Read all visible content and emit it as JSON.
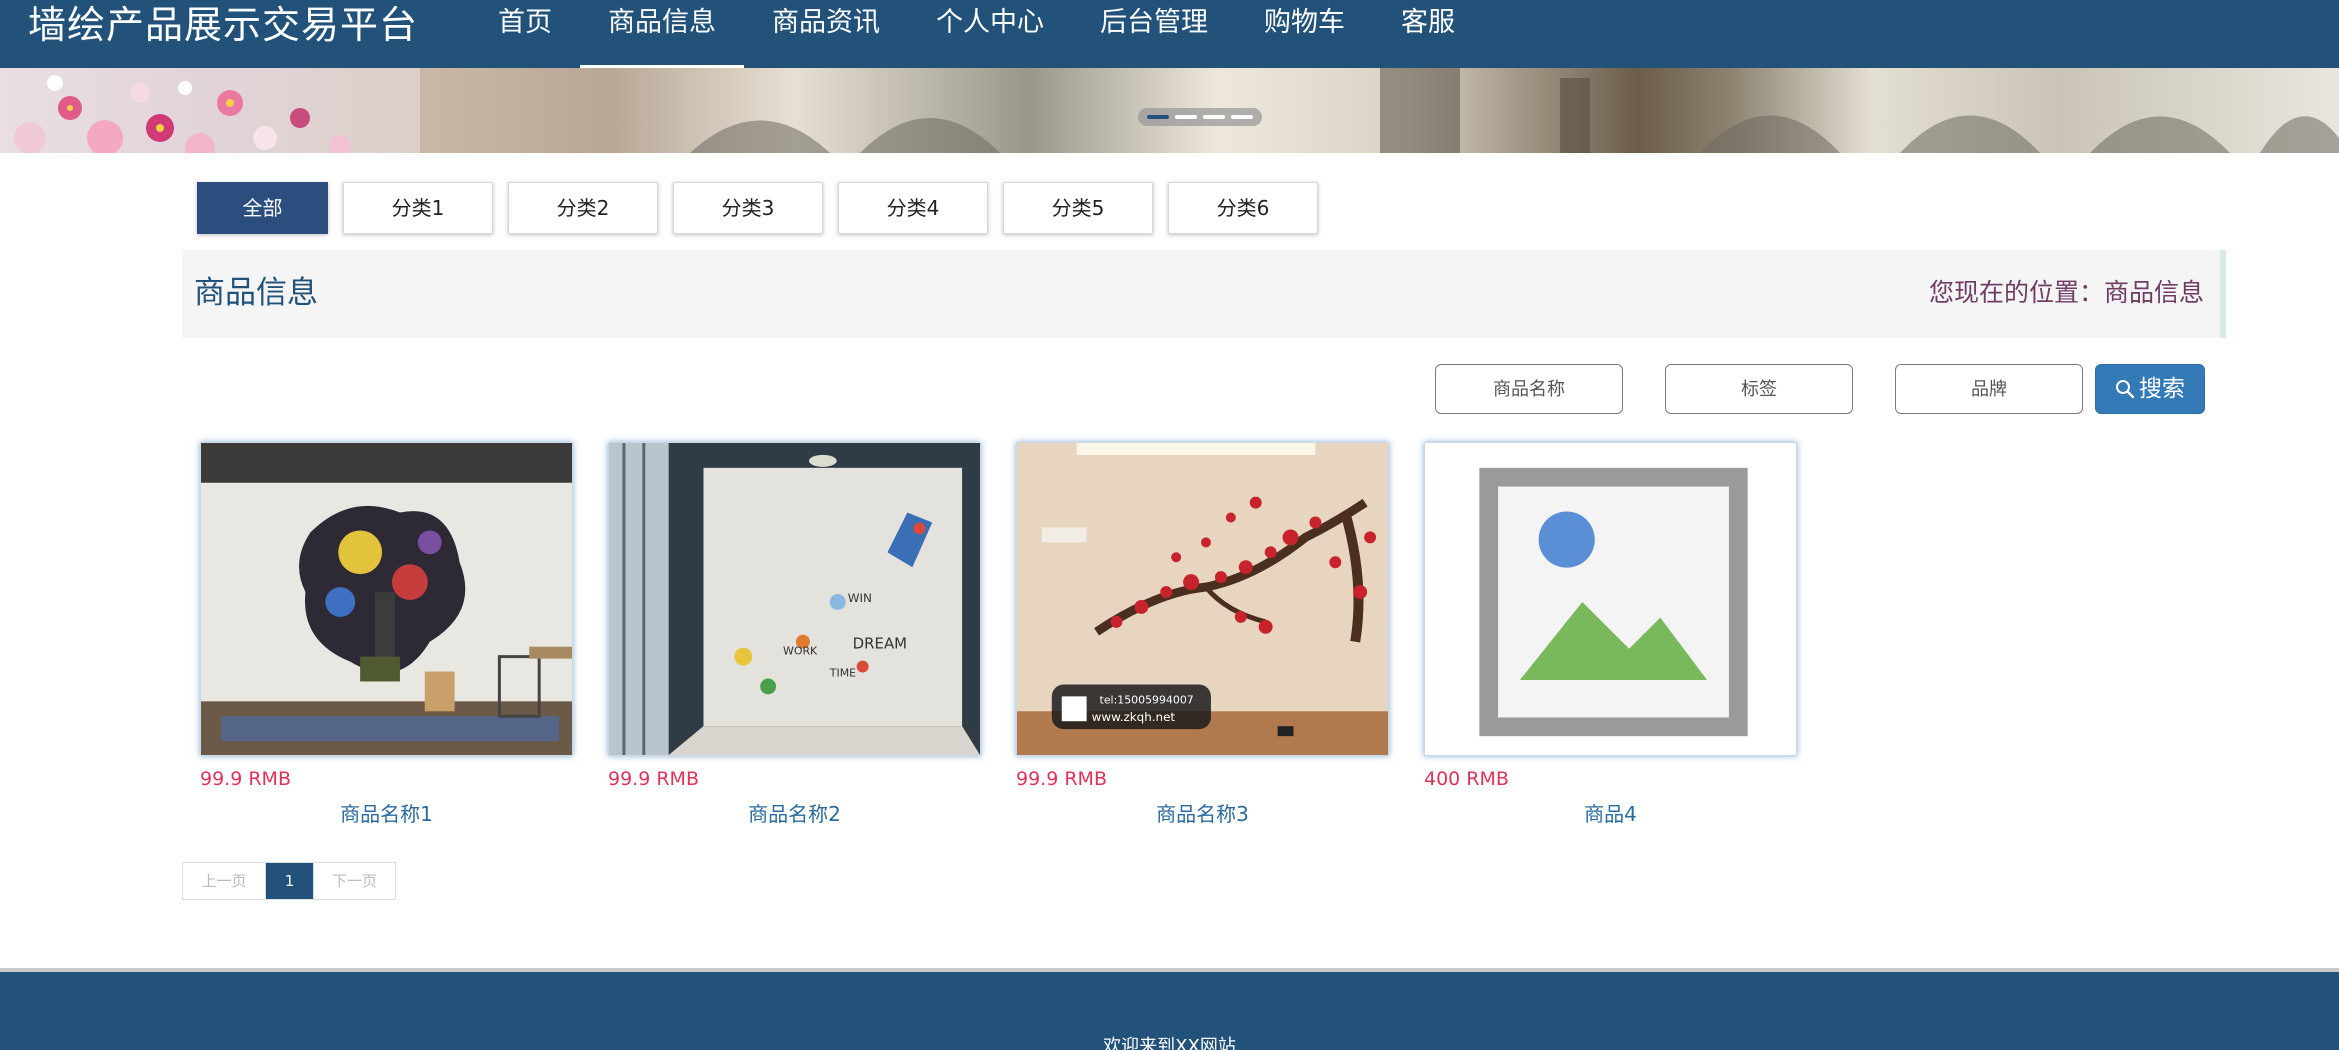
{
  "header": {
    "site_title": "墙绘产品展示交易平台",
    "nav": [
      {
        "label": "首页",
        "active": false
      },
      {
        "label": "商品信息",
        "active": true
      },
      {
        "label": "商品资讯",
        "active": false
      },
      {
        "label": "个人中心",
        "active": false
      },
      {
        "label": "后台管理",
        "active": false
      },
      {
        "label": "购物车",
        "active": false
      },
      {
        "label": "客服",
        "active": false
      }
    ]
  },
  "banner": {
    "slides": 4,
    "active_slide": 1
  },
  "categories": [
    {
      "label": "全部",
      "active": true
    },
    {
      "label": "分类1",
      "active": false
    },
    {
      "label": "分类2",
      "active": false
    },
    {
      "label": "分类3",
      "active": false
    },
    {
      "label": "分类4",
      "active": false
    },
    {
      "label": "分类5",
      "active": false
    },
    {
      "label": "分类6",
      "active": false
    }
  ],
  "titlebar": {
    "title": "商品信息",
    "location": "您现在的位置：商品信息"
  },
  "search": {
    "name_placeholder": "商品名称",
    "tag_placeholder": "标签",
    "brand_placeholder": "品牌",
    "button_label": "搜索"
  },
  "products": [
    {
      "price": "99.9 RMB",
      "name": "商品名称1",
      "image": "graffiti-mural"
    },
    {
      "price": "99.9 RMB",
      "name": "商品名称2",
      "image": "doodle-mural"
    },
    {
      "price": "99.9 RMB",
      "name": "商品名称3",
      "image": "plum-blossom-mural",
      "watermark_phone": "tel:15005994007",
      "watermark_site": "www.zkqh.net"
    },
    {
      "price": "400 RMB",
      "name": "商品4",
      "image": "broken-image"
    }
  ],
  "pagination": {
    "prev": "上一页",
    "current": "1",
    "next": "下一页"
  },
  "footer": {
    "text": "欢迎来到XX网站"
  },
  "colors": {
    "primary": "#22527a",
    "active_category": "#2c4e7f",
    "price": "#e0335a",
    "location": "#6f3c64",
    "search_button": "#337ab7"
  }
}
